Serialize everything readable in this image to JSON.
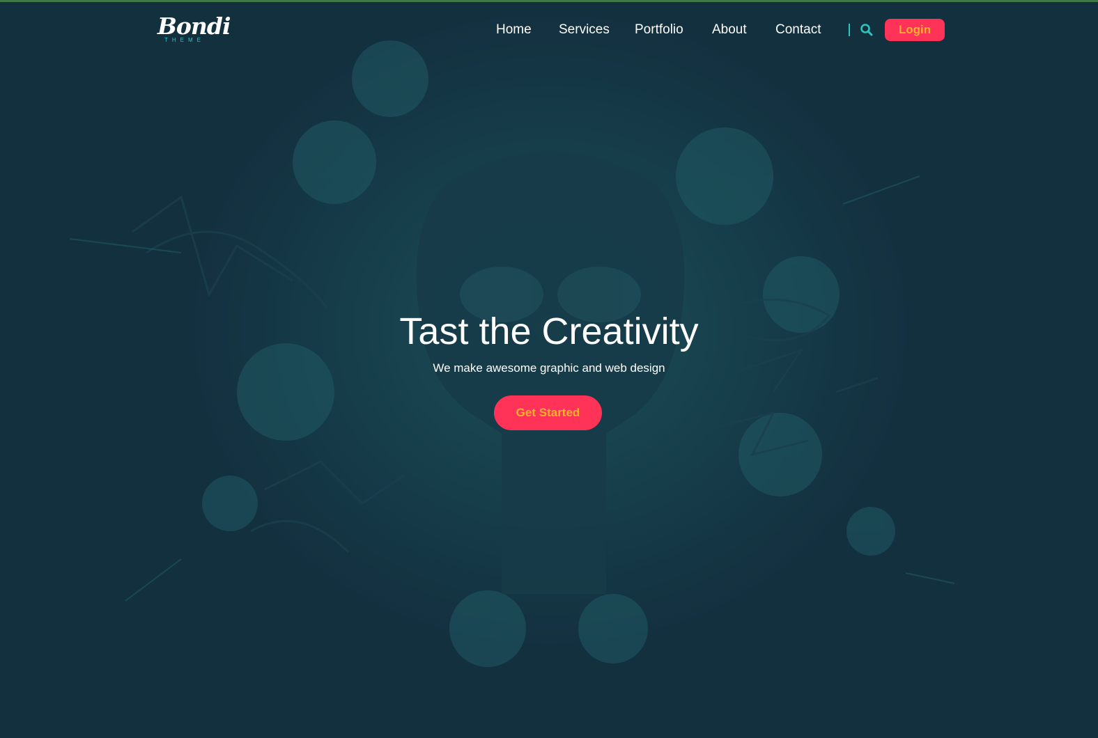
{
  "brand": {
    "name": "Bondi",
    "tagline": "THEME",
    "accent_color": "#2ec4c0",
    "cta_color": "#ff3358",
    "cta_text_color": "#ffb02e",
    "background_color": "#13303f"
  },
  "nav": {
    "items": [
      {
        "label": "Home"
      },
      {
        "label": "Services"
      },
      {
        "label": "Portfolio"
      },
      {
        "label": "About"
      },
      {
        "label": "Contact"
      }
    ],
    "search_icon": "search-icon",
    "login_label": "Login"
  },
  "hero": {
    "title": "Tast the Creativity",
    "subtitle": "We make awesome graphic and web design",
    "cta_label": "Get Started"
  }
}
